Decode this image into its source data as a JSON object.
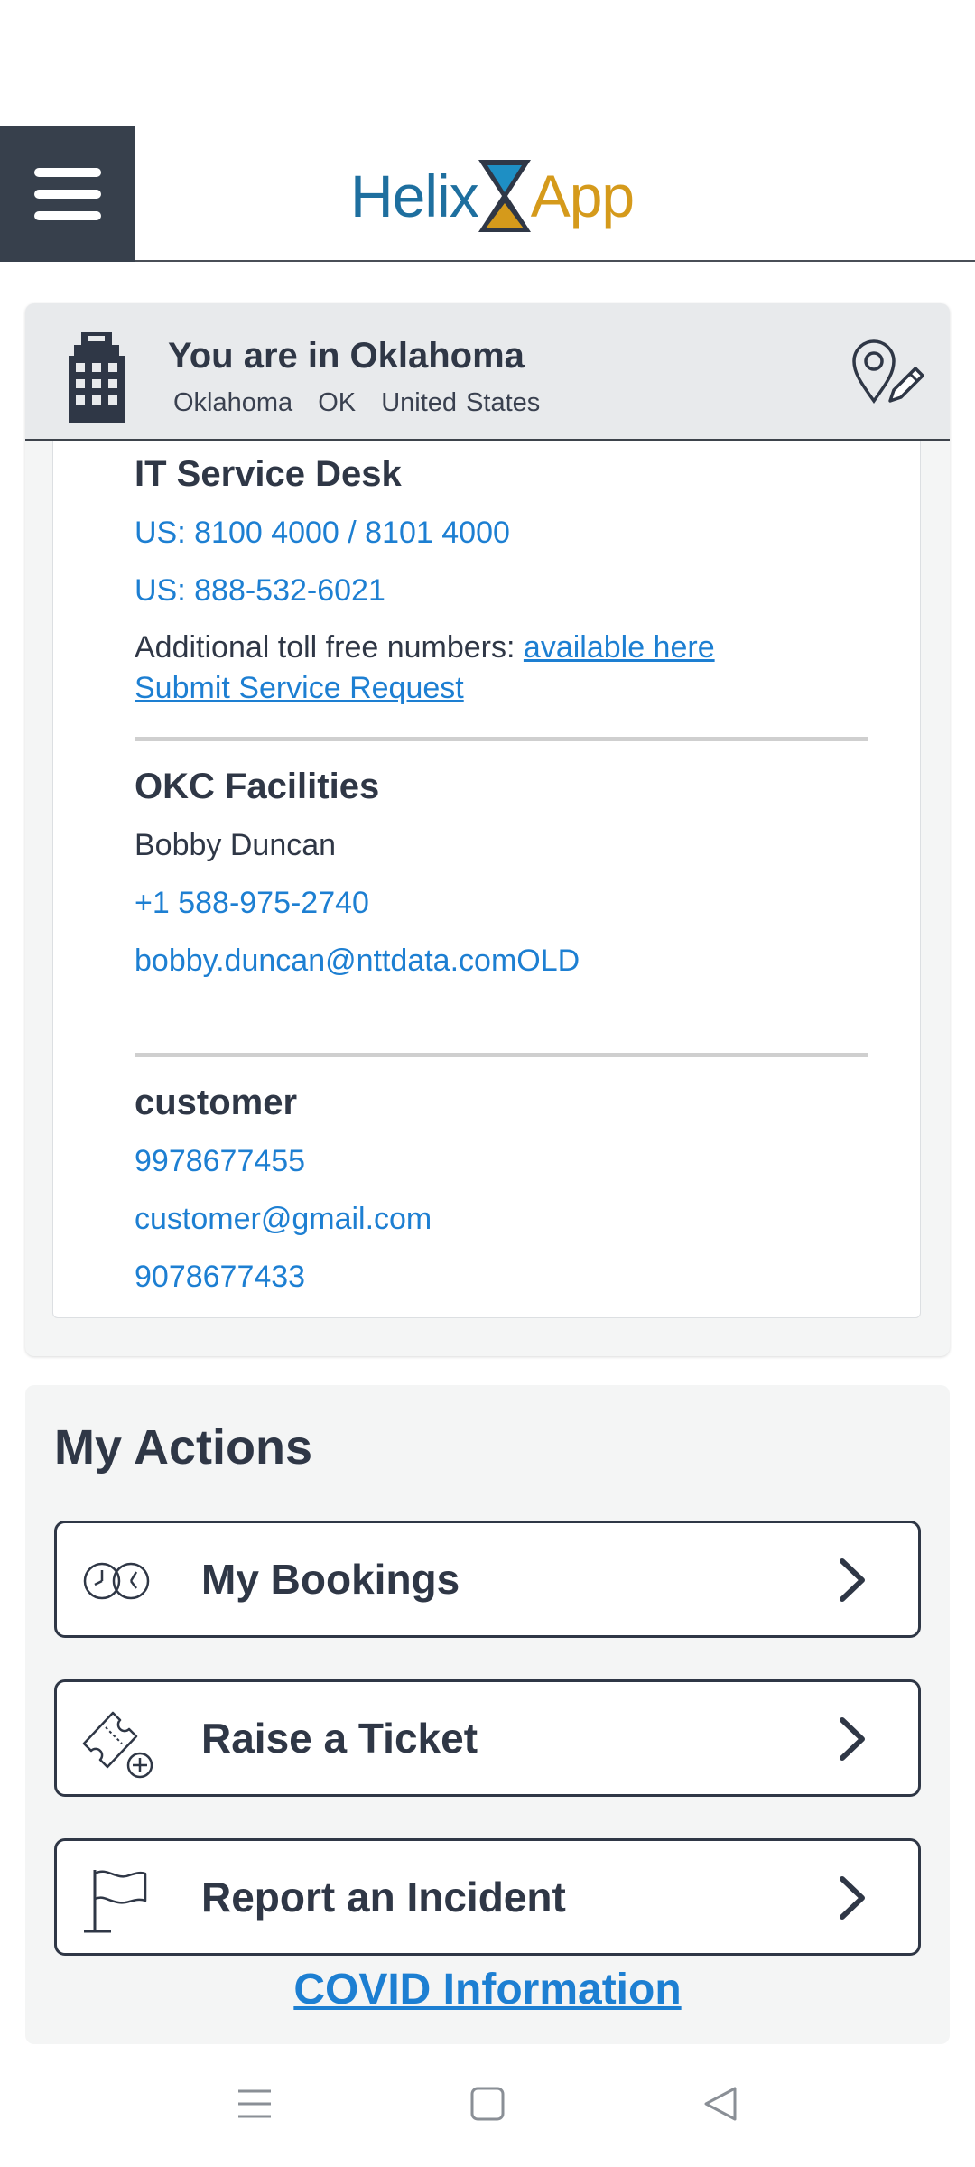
{
  "header": {
    "logo_part1": "Helix",
    "logo_part2": "App"
  },
  "location": {
    "title": "You are in Oklahoma",
    "city": "Oklahoma",
    "state": "OK",
    "country": "United States"
  },
  "contacts": {
    "it_desk": {
      "title": "IT Service Desk",
      "phone1": "US: 8100 4000 / 8101 4000",
      "phone2": "US: 888-532-6021",
      "toll_free_prefix": "Additional toll free numbers: ",
      "toll_free_link": "available here",
      "service_request": "Submit Service Request"
    },
    "facilities": {
      "title": "OKC Facilities",
      "name": "Bobby Duncan",
      "phone": "+1 588-975-2740",
      "email": "bobby.duncan@nttdata.comOLD"
    },
    "customer": {
      "title": "customer",
      "phone1": "9978677455",
      "email": "customer@gmail.com",
      "phone2": "9078677433"
    }
  },
  "actions": {
    "title": "My Actions",
    "items": [
      {
        "label": "My Bookings",
        "icon": "clocks-icon"
      },
      {
        "label": "Raise a Ticket",
        "icon": "ticket-add-icon"
      },
      {
        "label": "Report an Incident",
        "icon": "flag-icon"
      }
    ],
    "covid": "COVID Information"
  },
  "colors": {
    "header_dark": "#37404c",
    "link": "#1d7fd2",
    "logo_blue": "#1e6f9f",
    "logo_gold": "#d59a1b"
  }
}
